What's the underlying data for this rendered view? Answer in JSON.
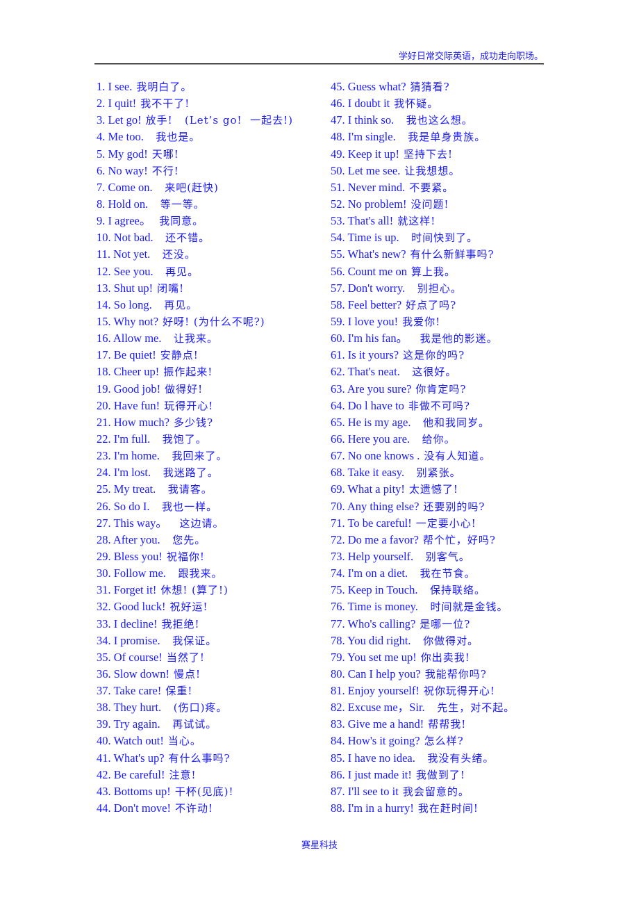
{
  "header": {
    "text": "学好日常交际英语，成功走向职场。"
  },
  "footer": {
    "text": "赛星科技"
  },
  "phrases": [
    {
      "num": "1.",
      "en": "I see.",
      "zh": "我明白了。"
    },
    {
      "num": "2.",
      "en": "I quit!",
      "zh": "我不干了!"
    },
    {
      "num": "3.",
      "en": "Let go!",
      "zh": "放手!   (Let’s go!  一起去!)"
    },
    {
      "num": "4.",
      "en": "Me too.",
      "zh": "  我也是。"
    },
    {
      "num": "5.",
      "en": "My god!",
      "zh": "天哪!"
    },
    {
      "num": "6.",
      "en": "No way!",
      "zh": "不行!"
    },
    {
      "num": "7.",
      "en": "Come on.",
      "zh": "  来吧(赶快)"
    },
    {
      "num": "8.",
      "en": "Hold on.",
      "zh": "  等一等。"
    },
    {
      "num": "9.",
      "en": "I agree。",
      "zh": " 我同意。"
    },
    {
      "num": "10.",
      "en": "Not bad.",
      "zh": "  还不错。"
    },
    {
      "num": "11.",
      "en": "Not yet.",
      "zh": "  还没。"
    },
    {
      "num": "12.",
      "en": "See you.",
      "zh": "  再见。"
    },
    {
      "num": "13.",
      "en": "Shut up!",
      "zh": "闭嘴!"
    },
    {
      "num": "14.",
      "en": "So long.",
      "zh": "  再见。"
    },
    {
      "num": "15.",
      "en": "Why not?",
      "zh": "好呀! (为什么不呢?)"
    },
    {
      "num": "16.",
      "en": "Allow me.",
      "zh": "  让我来。"
    },
    {
      "num": "17.",
      "en": "Be quiet!",
      "zh": "安静点!"
    },
    {
      "num": "18.",
      "en": "Cheer up!",
      "zh": "振作起来!"
    },
    {
      "num": "19.",
      "en": "Good job!",
      "zh": "做得好!"
    },
    {
      "num": "20.",
      "en": "Have fun!",
      "zh": "玩得开心!"
    },
    {
      "num": "21.",
      "en": "How much?",
      "zh": "多少钱?"
    },
    {
      "num": "22.",
      "en": "I'm full.",
      "zh": "  我饱了。"
    },
    {
      "num": "23.",
      "en": "I'm home.",
      "zh": "  我回来了。"
    },
    {
      "num": "24.",
      "en": "I'm lost.",
      "zh": "  我迷路了。"
    },
    {
      "num": "25.",
      "en": "My treat.",
      "zh": "  我请客。"
    },
    {
      "num": "26.",
      "en": "So do I.",
      "zh": "  我也一样。"
    },
    {
      "num": "27.",
      "en": "This way。",
      "zh": "  这边请。"
    },
    {
      "num": "28.",
      "en": "After you.",
      "zh": "  您先。"
    },
    {
      "num": "29.",
      "en": "Bless you!",
      "zh": "祝福你!"
    },
    {
      "num": "30.",
      "en": "Follow me.",
      "zh": "  跟我来。"
    },
    {
      "num": "31.",
      "en": "Forget it!",
      "zh": "休想! (算了!)"
    },
    {
      "num": "32.",
      "en": "Good luck!",
      "zh": "祝好运!"
    },
    {
      "num": "33.",
      "en": "I decline!",
      "zh": "我拒绝!"
    },
    {
      "num": "34.",
      "en": "I promise.",
      "zh": "  我保证。"
    },
    {
      "num": "35.",
      "en": "Of course!",
      "zh": "当然了!"
    },
    {
      "num": "36.",
      "en": "Slow down!",
      "zh": "慢点!"
    },
    {
      "num": "37.",
      "en": "Take care!",
      "zh": "保重!"
    },
    {
      "num": "38.",
      "en": "They hurt.",
      "zh": "  (伤口)疼。"
    },
    {
      "num": "39.",
      "en": "Try again.",
      "zh": "  再试试。"
    },
    {
      "num": "40.",
      "en": "Watch out!",
      "zh": "当心。"
    },
    {
      "num": "41.",
      "en": "What's up?",
      "zh": "有什么事吗?"
    },
    {
      "num": "42.",
      "en": "Be careful!",
      "zh": "注意!"
    },
    {
      "num": "43.",
      "en": "Bottoms up!",
      "zh": "干杯(见底)!"
    },
    {
      "num": "44.",
      "en": "Don't move!",
      "zh": "不许动!"
    },
    {
      "num": "45.",
      "en": "Guess what?",
      "zh": "猜猜看?"
    },
    {
      "num": "46.",
      "en": "I doubt it",
      "zh": "我怀疑。"
    },
    {
      "num": "47.",
      "en": "I think so.",
      "zh": "  我也这么想。"
    },
    {
      "num": "48.",
      "en": "I'm single.",
      "zh": "  我是单身贵族。"
    },
    {
      "num": "49.",
      "en": "Keep it up!",
      "zh": "坚持下去!"
    },
    {
      "num": "50.",
      "en": "Let me see.",
      "zh": "让我想想。"
    },
    {
      "num": "51.",
      "en": "Never mind.",
      "zh": "不要紧。"
    },
    {
      "num": "52.",
      "en": "No problem!",
      "zh": "没问题!"
    },
    {
      "num": "53.",
      "en": "That's all!",
      "zh": "就这样!"
    },
    {
      "num": "54.",
      "en": "Time is up.",
      "zh": "  时间快到了。"
    },
    {
      "num": "55.",
      "en": "What's new?",
      "zh": "有什么新鲜事吗?"
    },
    {
      "num": "56.",
      "en": "Count me on",
      "zh": "算上我。"
    },
    {
      "num": "57.",
      "en": "Don't worry.",
      "zh": "  别担心。"
    },
    {
      "num": "58.",
      "en": "Feel better?",
      "zh": "好点了吗?"
    },
    {
      "num": "59.",
      "en": "I love you!",
      "zh": "我爱你!"
    },
    {
      "num": "60.",
      "en": "I'm his fan。",
      "zh": "  我是他的影迷。"
    },
    {
      "num": "61.",
      "en": "Is it yours?",
      "zh": "这是你的吗?"
    },
    {
      "num": "62.",
      "en": "That's neat.",
      "zh": "  这很好。"
    },
    {
      "num": "63.",
      "en": "Are you sure?",
      "zh": "你肯定吗?"
    },
    {
      "num": "64.",
      "en": "Do l have to",
      "zh": "非做不可吗?"
    },
    {
      "num": "65.",
      "en": "He is my age.",
      "zh": "  他和我同岁。"
    },
    {
      "num": "66.",
      "en": "Here you are.",
      "zh": "  给你。"
    },
    {
      "num": "67.",
      "en": "No one knows .",
      "zh": "没有人知道。"
    },
    {
      "num": "68.",
      "en": "Take it easy.",
      "zh": "  别紧张。"
    },
    {
      "num": "69.",
      "en": "What a pity!",
      "zh": "太遗憾了!"
    },
    {
      "num": "70.",
      "en": "Any thing else?",
      "zh": "还要别的吗?"
    },
    {
      "num": "71.",
      "en": "To be careful!",
      "zh": "一定要小心!"
    },
    {
      "num": "72.",
      "en": "Do me a favor?",
      "zh": "帮个忙，好吗?"
    },
    {
      "num": "73.",
      "en": "Help yourself.",
      "zh": "  别客气。"
    },
    {
      "num": "74.",
      "en": "I'm on a diet.",
      "zh": "  我在节食。"
    },
    {
      "num": "75.",
      "en": "Keep in Touch.",
      "zh": "  保持联络。"
    },
    {
      "num": "76.",
      "en": "Time is money.",
      "zh": "  时间就是金钱。"
    },
    {
      "num": "77.",
      "en": "Who's calling?",
      "zh": "是哪一位?"
    },
    {
      "num": "78.",
      "en": "You did right.",
      "zh": "  你做得对。"
    },
    {
      "num": "79.",
      "en": "You set me up!",
      "zh": "你出卖我!"
    },
    {
      "num": "80.",
      "en": "Can I help you?",
      "zh": "我能帮你吗?"
    },
    {
      "num": "81.",
      "en": "Enjoy yourself!",
      "zh": "祝你玩得开心!"
    },
    {
      "num": "82.",
      "en": "Excuse me，Sir.",
      "zh": "  先生，对不起。"
    },
    {
      "num": "83.",
      "en": "Give me a hand!",
      "zh": "帮帮我!"
    },
    {
      "num": "84.",
      "en": "How's it going?",
      "zh": "怎么样?"
    },
    {
      "num": "85.",
      "en": "I have no idea.",
      "zh": "  我没有头绪。"
    },
    {
      "num": "86.",
      "en": "I just made it!",
      "zh": "我做到了!"
    },
    {
      "num": "87.",
      "en": "I'll see to it",
      "zh": "我会留意的。"
    },
    {
      "num": "88.",
      "en": "I'm in a hurry!",
      "zh": "我在赶时间!"
    }
  ]
}
